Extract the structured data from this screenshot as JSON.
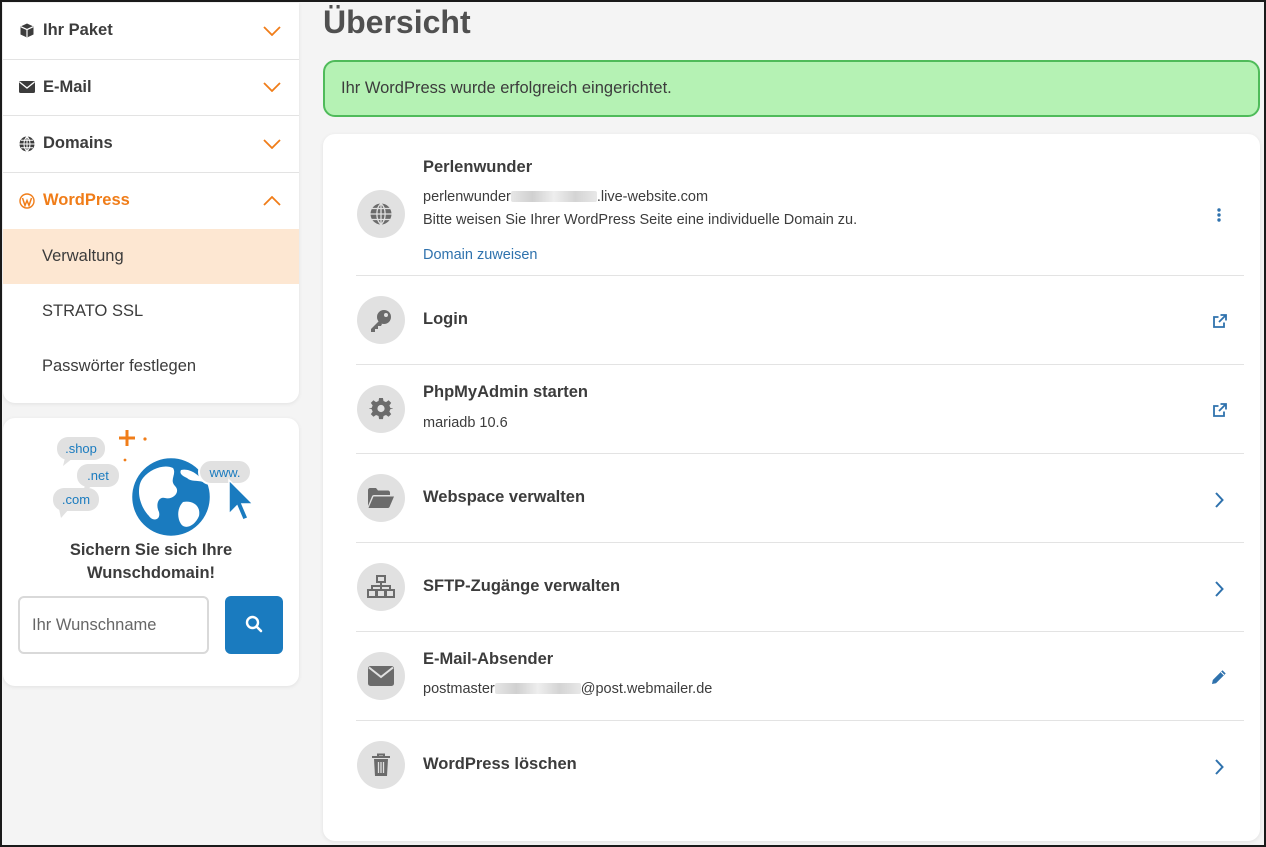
{
  "sidebar": {
    "sections": [
      {
        "label": "Ihr Paket",
        "icon": "box-icon"
      },
      {
        "label": "E-Mail",
        "icon": "envelope-icon"
      },
      {
        "label": "Domains",
        "icon": "globe-icon"
      },
      {
        "label": "WordPress",
        "icon": "wordpress-icon"
      }
    ],
    "wordpress_items": [
      {
        "label": "Verwaltung"
      },
      {
        "label": "STRATO SSL"
      },
      {
        "label": "Passwörter festlegen"
      }
    ]
  },
  "promo": {
    "bubbles": [
      ".shop",
      ".net",
      ".com",
      "www."
    ],
    "title_line1": "Sichern Sie sich Ihre",
    "title_line2": "Wunschdomain!",
    "input_placeholder": "Ihr Wunschname"
  },
  "main": {
    "title": "Übersicht",
    "alert": "Ihr WordPress wurde erfolgreich eingerichtet.",
    "rows": [
      {
        "title": "Perlenwunder",
        "domain_prefix": "perlenwunder",
        "domain_suffix": ".live-website.com",
        "note": "Bitte weisen Sie Ihrer WordPress Seite eine individuelle Domain zu.",
        "link": "Domain zuweisen",
        "icon": "globe-icon",
        "action": "more-vertical-icon"
      },
      {
        "title": "Login",
        "icon": "key-icon",
        "action": "external-link-icon"
      },
      {
        "title": "PhpMyAdmin starten",
        "sub": "mariadb 10.6",
        "icon": "gear-icon",
        "action": "external-link-icon"
      },
      {
        "title": "Webspace verwalten",
        "icon": "folder-open-icon",
        "action": "chevron-right-icon"
      },
      {
        "title": "SFTP-Zugänge verwalten",
        "icon": "network-icon",
        "action": "chevron-right-icon"
      },
      {
        "title": "E-Mail-Absender",
        "sub_prefix": "postmaster",
        "sub_suffix": "@post.webmailer.de",
        "icon": "envelope-icon",
        "action": "pencil-icon"
      },
      {
        "title": "WordPress löschen",
        "icon": "trash-icon",
        "action": "chevron-right-icon"
      }
    ]
  },
  "colors": {
    "accent_orange": "#f07d19",
    "primary_blue": "#1a7bbf",
    "link_blue": "#2f72ad",
    "success_bg": "#b5f2b4",
    "success_border": "#4fbb5a"
  }
}
